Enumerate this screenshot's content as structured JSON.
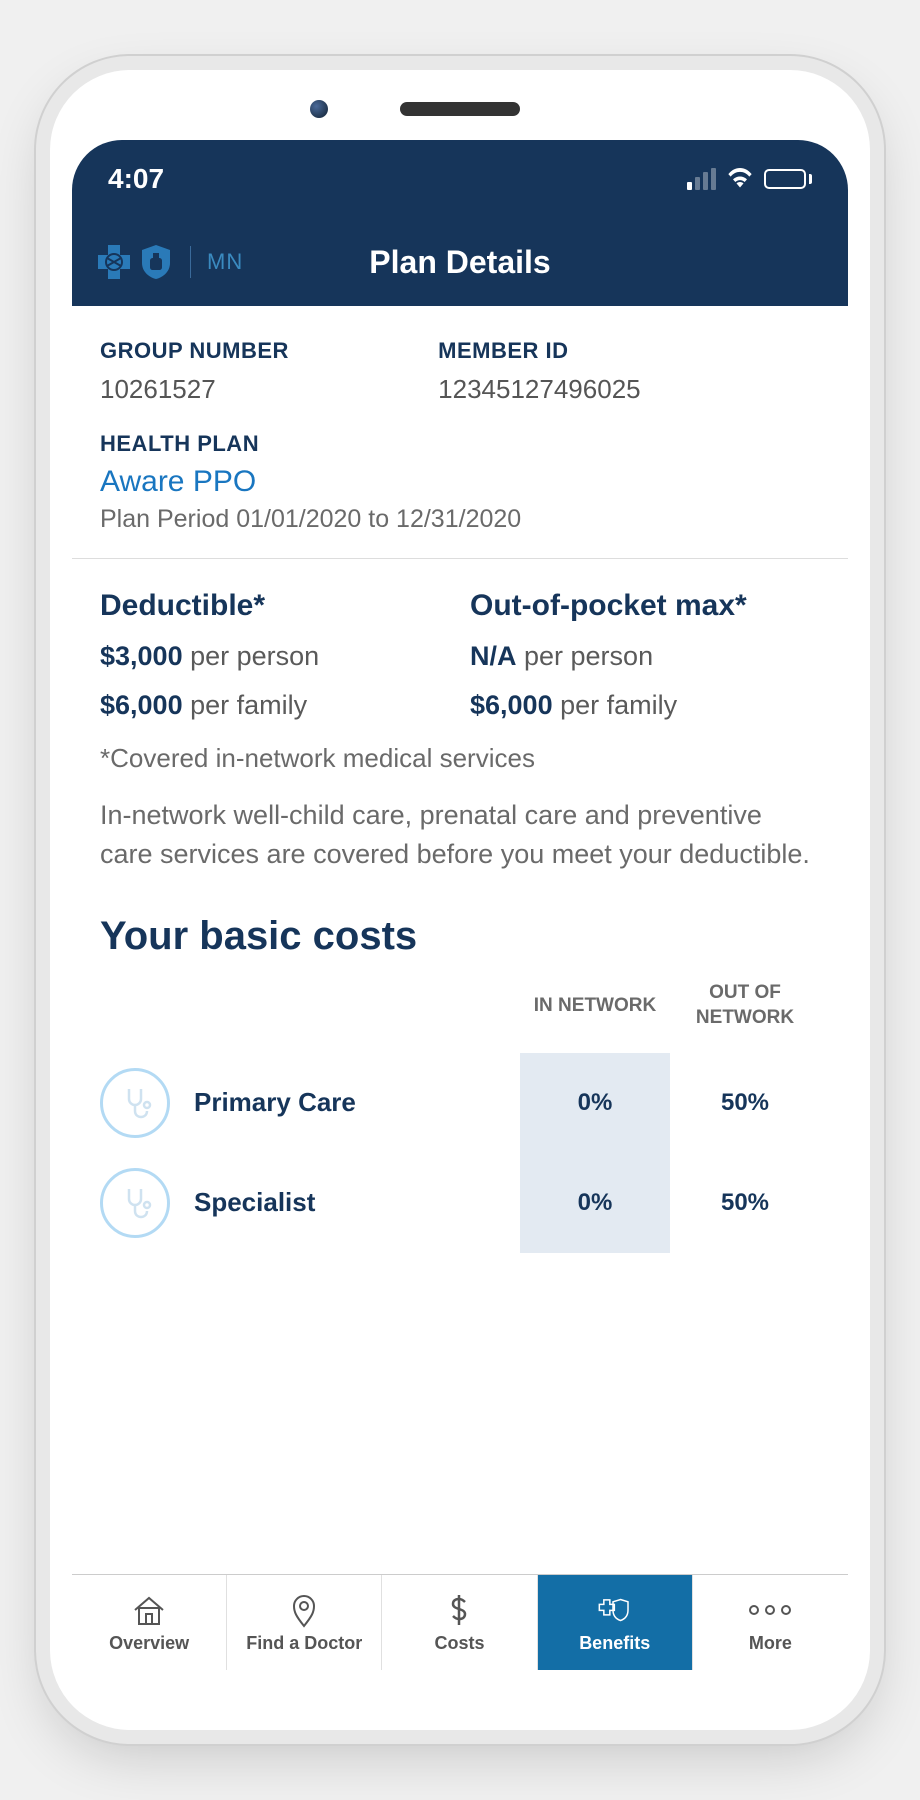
{
  "status_bar": {
    "time": "4:07"
  },
  "header": {
    "state_code": "MN",
    "title": "Plan Details"
  },
  "plan_info": {
    "group_number_label": "GROUP NUMBER",
    "group_number": "10261527",
    "member_id_label": "MEMBER ID",
    "member_id": "12345127496025",
    "health_plan_label": "HEALTH PLAN",
    "plan_name": "Aware PPO",
    "plan_period": "Plan Period 01/01/2020 to 12/31/2020"
  },
  "cost_summary": {
    "deductible_label": "Deductible*",
    "oop_max_label": "Out-of-pocket max*",
    "deductible_person_amount": "$3,000",
    "deductible_person_suffix": " per person",
    "oop_person_amount": "N/A",
    "oop_person_suffix": " per person",
    "deductible_family_amount": "$6,000",
    "deductible_family_suffix": " per family",
    "oop_family_amount": "$6,000",
    "oop_family_suffix": " per family",
    "footnote": "*Covered in-network medical services",
    "preventive_note": "In-network well-child care, prenatal care and preventive care services are covered before you meet your deductible."
  },
  "basic_costs": {
    "title": "Your basic costs",
    "col_in": "IN NETWORK",
    "col_out": "OUT OF NETWORK",
    "rows": [
      {
        "label": "Primary Care",
        "in_network": "0%",
        "out_network": "50%"
      },
      {
        "label": "Specialist",
        "in_network": "0%",
        "out_network": "50%"
      }
    ]
  },
  "tabs": {
    "overview": "Overview",
    "find_doctor": "Find a Doctor",
    "costs": "Costs",
    "benefits": "Benefits",
    "more": "More"
  }
}
